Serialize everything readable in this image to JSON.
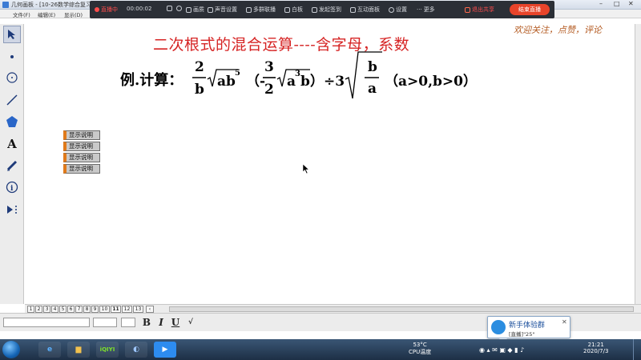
{
  "window": {
    "title": "几何画板 - [10-26数学综合复习...]",
    "menu": [
      "文件(F)",
      "编辑(E)",
      "显示(D)"
    ]
  },
  "livebar": {
    "status": "直播中",
    "timer": "00:00:02",
    "items": [
      "画质",
      "声音设置",
      "多群联播",
      "白板",
      "发起签到",
      "互动面板",
      "设置",
      "更多"
    ],
    "share_label": "退出共享",
    "end_label": "结束直播",
    "accent": "#e8442a"
  },
  "canvas": {
    "heading": "二次根式的混合运算----含字母，系数",
    "promo": "欢迎关注，点赞，评论",
    "formula": {
      "label": "例.计算：",
      "frac1_num": "2",
      "frac1_den": "b",
      "rad1_base": "ab",
      "rad1_exp": "5",
      "paren_open": "（-",
      "frac2_num": "3",
      "frac2_den": "2",
      "rad2_a": "a",
      "rad2_exp": "3",
      "rad2_b": "b",
      "paren_close": "）÷3",
      "frac3_num": "b",
      "frac3_den": "a",
      "condition": "（a>0,b>0）"
    },
    "buttons": [
      "显示说明",
      "显示说明",
      "显示说明",
      "显示说明"
    ],
    "heading_color": "#d62424",
    "promo_color": "#b3591f"
  },
  "page_tabs": [
    "1",
    "2",
    "3",
    "4",
    "5",
    "6",
    "7",
    "8",
    "9",
    "10",
    "11",
    "12",
    "13"
  ],
  "fmt": {
    "bold": "B",
    "italic": "I",
    "underline": "U"
  },
  "notification": {
    "title": "新手体验群",
    "subtitle": "[直播]\"25\""
  },
  "tray": {
    "temperature": "53°C",
    "cpu_label": "CPU温度",
    "time": "21:21",
    "date": "2020/7/3"
  }
}
